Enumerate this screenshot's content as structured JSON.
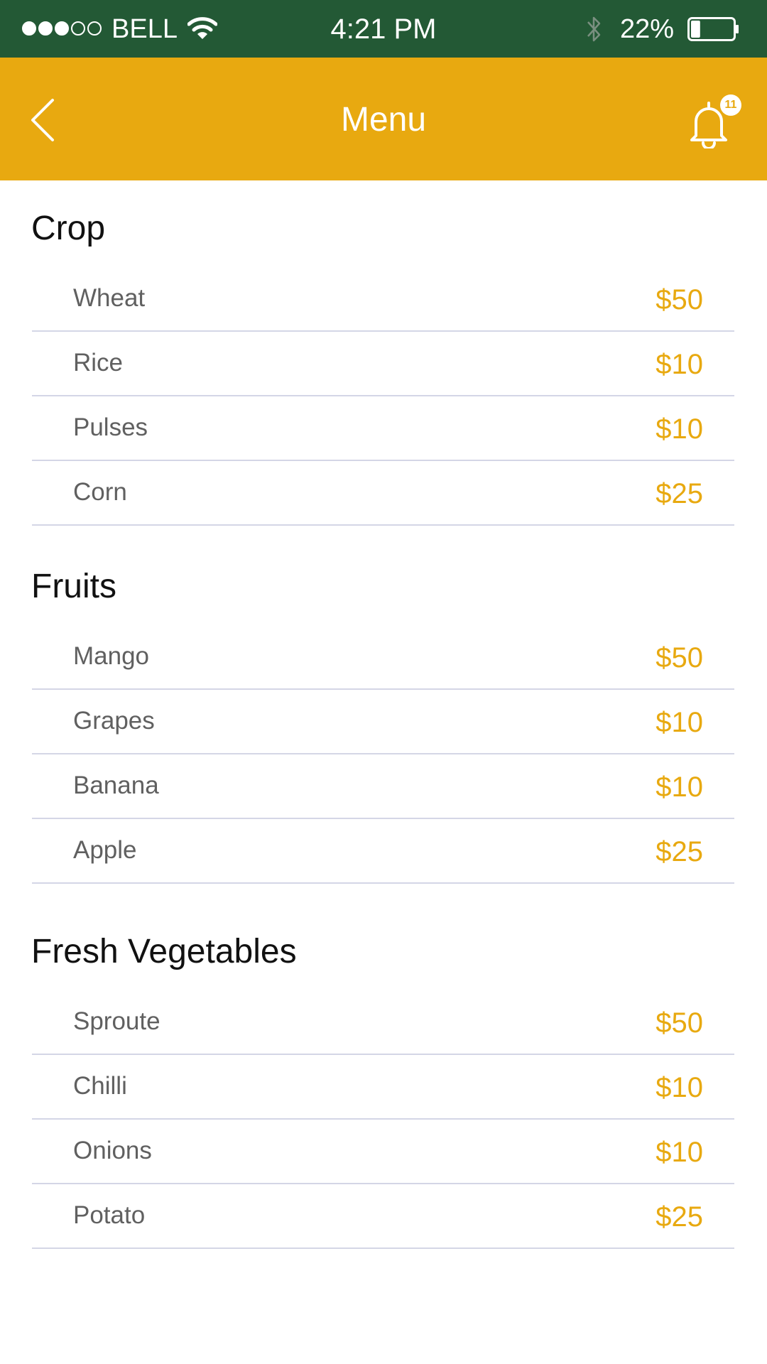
{
  "status_bar": {
    "carrier": "BELL",
    "time": "4:21 PM",
    "battery_percent": "22%",
    "battery_level": 0.22,
    "signal_strength": 3,
    "signal_max": 5,
    "icons": [
      "wifi-icon",
      "bluetooth-icon",
      "battery-icon"
    ]
  },
  "header": {
    "title": "Menu",
    "notification_count": "11",
    "icons": [
      "back-chevron-icon",
      "bell-icon"
    ]
  },
  "colors": {
    "status_bar": "#235935",
    "accent": "#e8a910",
    "divider": "#d4d6e6",
    "item_text": "#606060"
  },
  "sections": [
    {
      "title": "Crop",
      "items": [
        {
          "name": "Wheat",
          "price": "$50"
        },
        {
          "name": "Rice",
          "price": "$10"
        },
        {
          "name": "Pulses",
          "price": "$10"
        },
        {
          "name": "Corn",
          "price": "$25"
        }
      ]
    },
    {
      "title": "Fruits",
      "items": [
        {
          "name": "Mango",
          "price": "$50"
        },
        {
          "name": "Grapes",
          "price": "$10"
        },
        {
          "name": "Banana",
          "price": "$10"
        },
        {
          "name": "Apple",
          "price": "$25"
        }
      ]
    },
    {
      "title": "Fresh Vegetables",
      "items": [
        {
          "name": "Sproute",
          "price": "$50"
        },
        {
          "name": "Chilli",
          "price": "$10"
        },
        {
          "name": "Onions",
          "price": "$10"
        },
        {
          "name": "Potato",
          "price": "$25"
        }
      ]
    }
  ]
}
